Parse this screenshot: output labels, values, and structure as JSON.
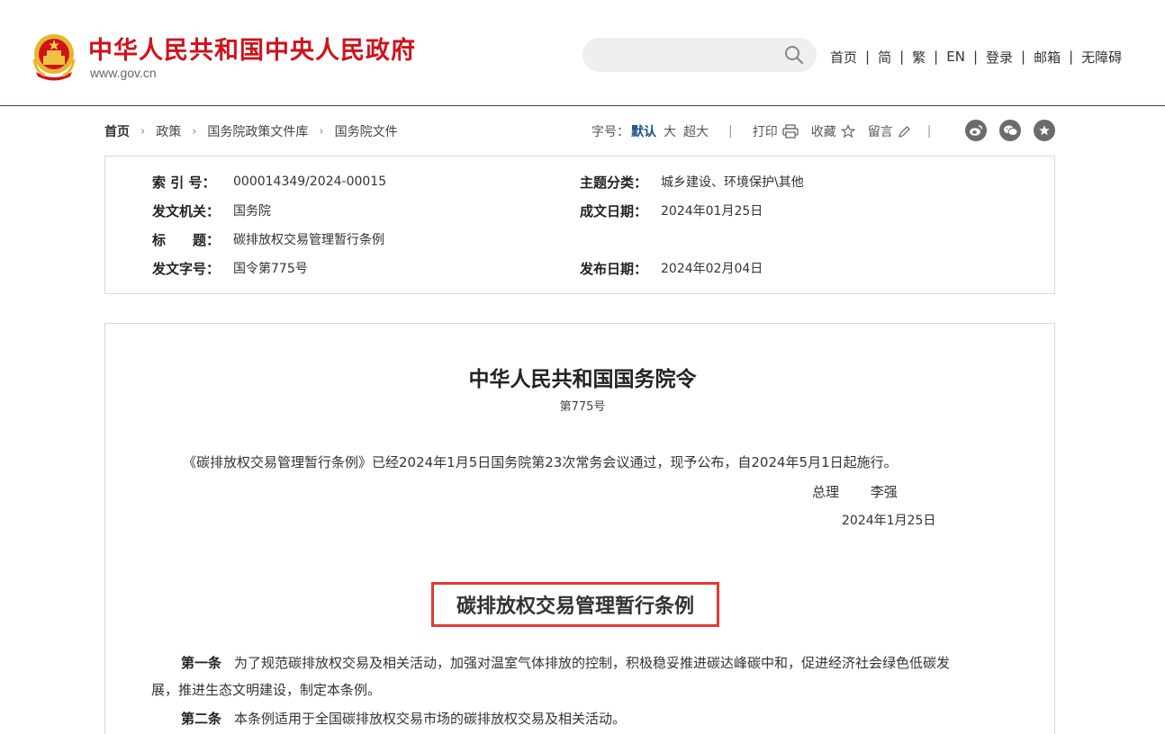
{
  "header": {
    "site_title": "中华人民共和国中央人民政府",
    "site_url": "www.gov.cn",
    "search_placeholder": "",
    "nav": [
      {
        "label": "首页"
      },
      {
        "label": "简"
      },
      {
        "label": "繁"
      },
      {
        "label": "EN"
      },
      {
        "label": "登录"
      },
      {
        "label": "邮箱"
      },
      {
        "label": "无障碍"
      }
    ],
    "nav_separator": "|",
    "colors": {
      "brand_red": "#d0121b",
      "rule": "#2b4a5e"
    }
  },
  "breadcrumb": {
    "items": [
      "首页",
      "政策",
      "国务院政策文件库",
      "国务院文件"
    ],
    "separator": "›"
  },
  "toolbar": {
    "font_size_label": "字号：",
    "font_default": "默认",
    "font_large": "大",
    "font_xlarge": "超大",
    "print_label": "打印",
    "collect_label": "收藏",
    "comment_label": "留言",
    "divider": "|",
    "share_icons": [
      "weibo-icon",
      "wechat-icon",
      "star-icon"
    ]
  },
  "meta": {
    "index_label": "索 引 号：",
    "index_value": "000014349/2024-00015",
    "topic_label": "主题分类：",
    "topic_value": "城乡建设、环境保护\\其他",
    "issuer_label": "发文机关：",
    "issuer_value": "国务院",
    "written_label": "成文日期：",
    "written_value": "2024年01月25日",
    "title_label": "标　　题：",
    "title_value": "碳排放权交易管理暂行条例",
    "docno_label": "发文字号：",
    "docno_value": "国令第775号",
    "published_label": "发布日期：",
    "published_value": "2024年02月04日"
  },
  "document": {
    "order_title": "中华人民共和国国务院令",
    "order_no": "第775号",
    "preamble": "《碳排放权交易管理暂行条例》已经2024年1月5日国务院第23次常务会议通过，现予公布，自2024年5月1日起施行。",
    "signer_role": "总理",
    "signer_name": "李强",
    "sign_date": "2024年1月25日",
    "regulation_title": "碳排放权交易管理暂行条例",
    "highlight_color": "#e53935",
    "articles": [
      {
        "no": "第一条",
        "text": "为了规范碳排放权交易及相关活动，加强对温室气体排放的控制，积极稳妥推进碳达峰碳中和，促进经济社会绿色低碳发",
        "text_cont": "展，推进生态文明建设，制定本条例。"
      },
      {
        "no": "第二条",
        "text": "本条例适用于全国碳排放权交易市场的碳排放权交易及相关活动。"
      }
    ]
  }
}
